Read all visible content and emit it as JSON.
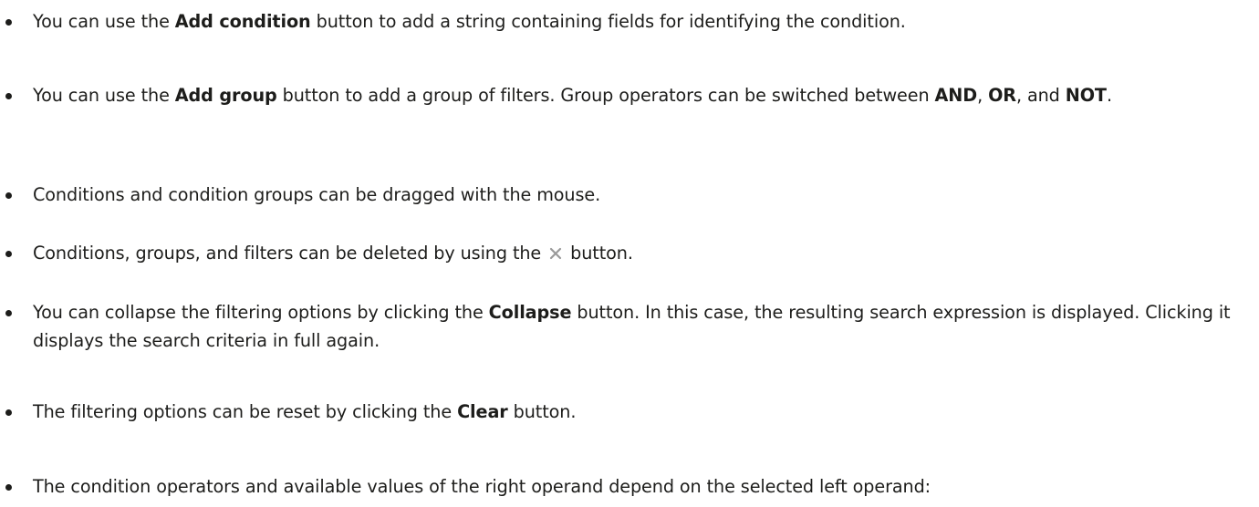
{
  "items": [
    {
      "t1": "You can use the ",
      "b1": "Add condition",
      "t2": " button to add a string containing fields for identifying the condition."
    },
    {
      "t1": "You can use the ",
      "b1": "Add group",
      "t2": " button to add a group of filters. Group operators can be switched between ",
      "b2": "AND",
      "t3": ", ",
      "b3": "OR",
      "t4": ", and ",
      "b4": "NOT",
      "t5": "."
    },
    {
      "t1": "Conditions and condition groups can be dragged with the mouse."
    },
    {
      "t1": "Conditions, groups, and filters can be deleted by using the ",
      "icon": "close-icon",
      "t2": " button."
    },
    {
      "t1": "You can collapse the filtering options by clicking the ",
      "b1": "Collapse",
      "t2": " button. In this case, the resulting search expression is displayed. Clicking it displays the search criteria in full again."
    },
    {
      "t1": "The filtering options can be reset by clicking the ",
      "b1": "Clear",
      "t2": " button."
    },
    {
      "t1": "The condition operators and available values of the right operand depend on the selected left operand:"
    }
  ],
  "colors": {
    "text": "#1d1d1b",
    "icon": "#9a9a9a"
  }
}
